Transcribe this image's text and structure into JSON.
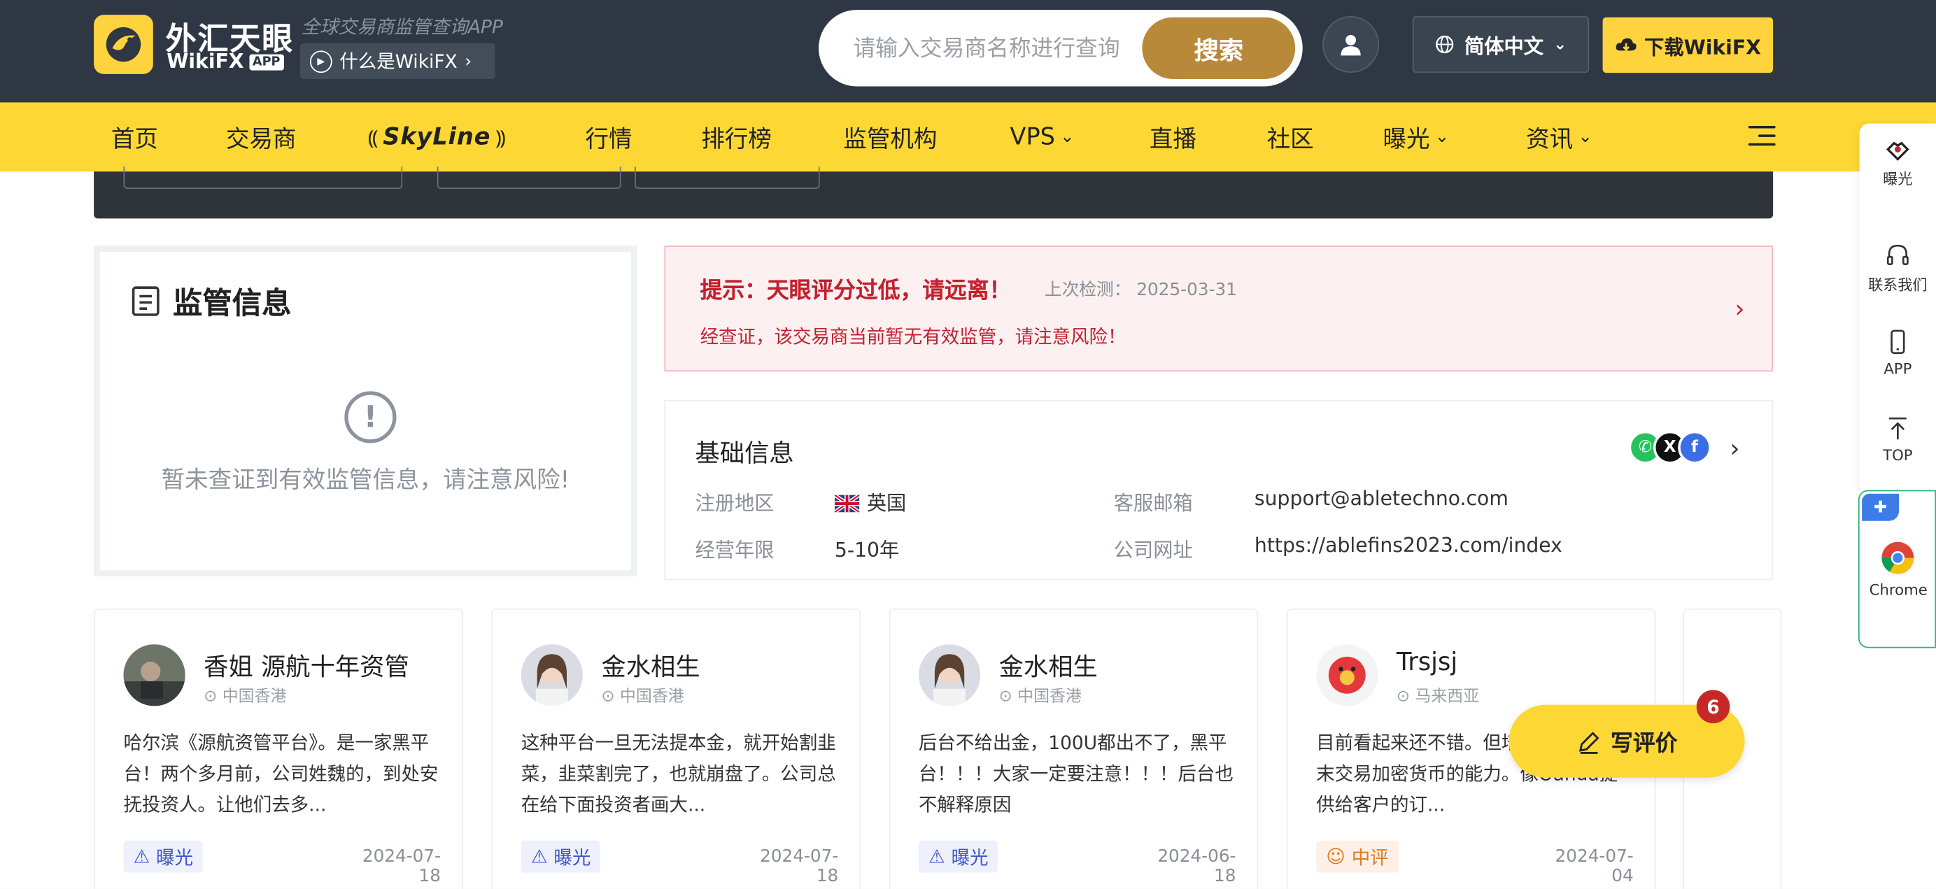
{
  "header": {
    "brand_cn": "外汇天眼",
    "brand_en": "WikiFX",
    "brand_app": "APP",
    "slogan": "全球交易商监管查询APP",
    "what_is": "什么是WikiFX",
    "search_placeholder": "请输入交易商名称进行查询",
    "search_button": "搜索",
    "language": "简体中文",
    "download": "下载WikiFX"
  },
  "nav": {
    "items": [
      "首页",
      "交易商",
      "SkyLine",
      "行情",
      "排行榜",
      "监管机构",
      "VPS",
      "直播",
      "社区",
      "曝光",
      "资讯"
    ]
  },
  "regulation": {
    "title": "监管信息",
    "empty_text": "暂未查证到有效监管信息，请注意风险!"
  },
  "warning": {
    "title": "提示：天眼评分过低，请远离！",
    "last_check": "上次检测： 2025-03-31",
    "body": "经查证，该交易商当前暂无有效监管，请注意风险！"
  },
  "basic_info": {
    "title": "基础信息",
    "region_label": "注册地区",
    "region_value": "英国",
    "years_label": "经营年限",
    "years_value": "5-10年",
    "email_label": "客服邮箱",
    "email_value": "support@abletechno.com",
    "site_label": "公司网址",
    "site_value": "https://ablefins2023.com/index"
  },
  "reviews": [
    {
      "name": "香姐 源航十年资管",
      "location": "中国香港",
      "text": "哈尔滨《源航资管平台》。是一家黑平台！两个多月前，公司姓魏的，到处安抚投资人。让他们去多...",
      "tag": "曝光",
      "date": "2024-07-18"
    },
    {
      "name": "金水相生",
      "location": "中国香港",
      "text": "这种平台一旦无法提本金，就开始割韭菜，韭菜割完了，也就崩盘了。公司总在给下面投资者画大...",
      "tag": "曝光",
      "date": "2024-07-18"
    },
    {
      "name": "金水相生",
      "location": "中国香港",
      "text": "后台不给出金，100U都出不了，黑平台！！！大家一定要注意！！！后台也不解释原因",
      "tag": "曝光",
      "date": "2024-06-18"
    },
    {
      "name": "Trsjsj",
      "location": "马来西亚",
      "text": "目前看起来还不错。但培训资源和在周末交易加密货币的能力。像Oanda提供给客户的订...",
      "tag": "中评",
      "date": "2024-07-04"
    }
  ],
  "write_review": {
    "label": "写评价",
    "badge": "6"
  },
  "rail": {
    "exposure": "曝光",
    "contact": "联系我们",
    "app": "APP",
    "top": "TOP",
    "chrome": "Chrome"
  },
  "colors": {
    "header_bg": "#2e3743",
    "nav_bg": "#fdd835",
    "search_btn": "#b9893a",
    "warning_red": "#c2202e"
  }
}
